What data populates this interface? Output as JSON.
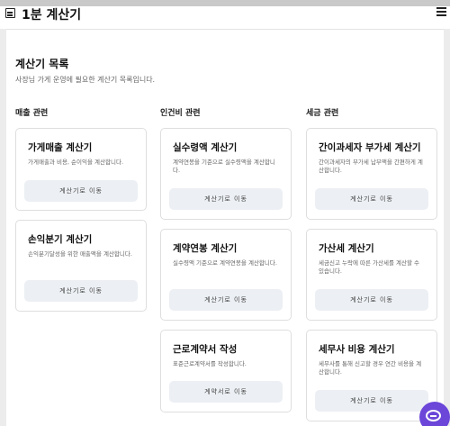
{
  "header": {
    "app_title": "1분 계산기",
    "logo_icon": "calculator-icon",
    "menu_icon": "hamburger-menu-icon"
  },
  "page": {
    "title": "계산기 목록",
    "subtitle": "사장님 가게 운영에 필요한 계산기 목록입니다."
  },
  "columns": [
    {
      "title": "매출 관련",
      "cards": [
        {
          "title": "가게매출 계산기",
          "desc": "가게매출과 비용, 순이익을 계산합니다.",
          "button": "계산기로 이동"
        },
        {
          "title": "손익분기 계산기",
          "desc": "손익분기달성을 위한 매출액을 계산합니다.",
          "button": "계산기로 이동"
        }
      ]
    },
    {
      "title": "인건비 관련",
      "cards": [
        {
          "title": "실수령액 계산기",
          "desc": "계약연봉을 기준으로 실수령액을 계산합니다.",
          "button": "계산기로 이동"
        },
        {
          "title": "계약연봉 계산기",
          "desc": "실수령액 기준으로 계약연봉을 계산합니다.",
          "button": "계산기로 이동"
        },
        {
          "title": "근로계약서 작성",
          "desc": "표준근로계약서를 작성합니다.",
          "button": "계약서로 이동"
        }
      ]
    },
    {
      "title": "세금 관련",
      "cards": [
        {
          "title": "간이과세자 부가세 계산기",
          "desc": "간이과세자의 부가세 납부액을 간편하게 계산합니다.",
          "button": "계산기로 이동"
        },
        {
          "title": "가산세 계산기",
          "desc": "세금신고 누락에 따른 가산세를 계산할 수 있습니다.",
          "button": "계산기로 이동"
        },
        {
          "title": "세무사 비용 계산기",
          "desc": "세무사를 통해 신고할 경우 연간 비용을 계산합니다.",
          "button": "계산기로 이동"
        }
      ]
    }
  ],
  "chat": {
    "icon": "chat-bubble-icon",
    "color": "#6b46d9"
  }
}
